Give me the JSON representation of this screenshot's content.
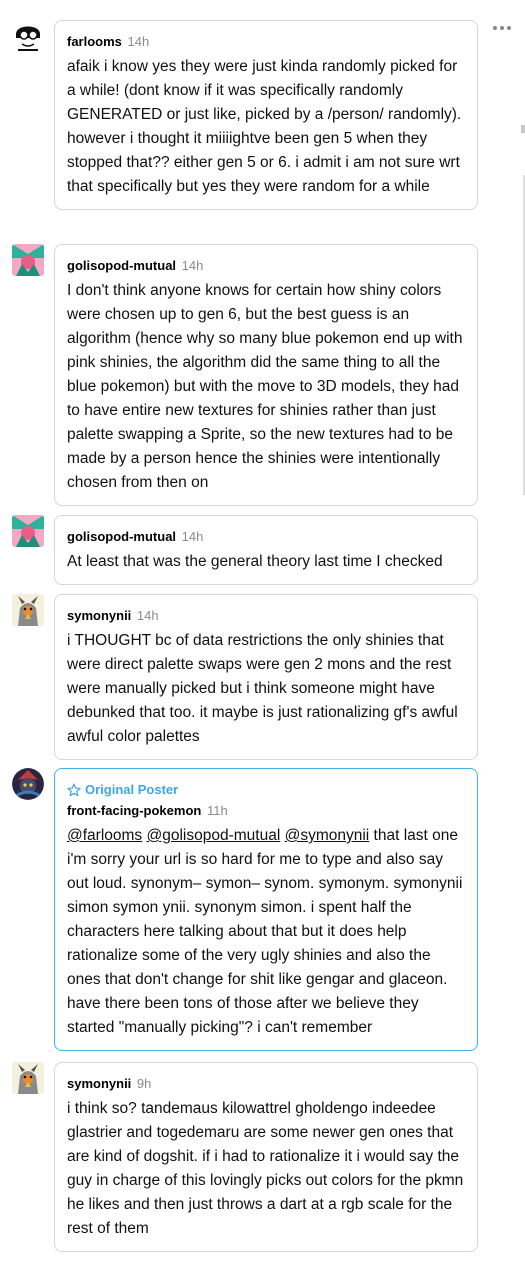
{
  "op_badge": "Original Poster",
  "replies": [
    {
      "username": "farlooms",
      "time": "14h",
      "text": "afaik i know yes they were just kinda randomly picked for a while! (dont know if it was specifically randomly GENERATED or just like, picked by a /person/ randomly). however i thought it miiiightve been gen 5 when they stopped that?? either gen 5 or 6. i admit i am not sure wrt that specifically but yes they were random for a while",
      "avatar_icon": "bw-drawing-avatar-icon"
    },
    {
      "username": "golisopod-mutual",
      "time": "14h",
      "text": "I don't think anyone knows for certain how shiny colors were chosen up to gen 6, but the best guess is an algorithm (hence why so many blue pokemon end up with pink shinies, the algorithm did the same thing to all the blue pokemon) but with the move to 3D models, they had to have entire new textures for shinies rather than just palette swapping a Sprite, so the new textures had to be made by a person hence the shinies were intentionally chosen from then on",
      "avatar_icon": "pink-teal-avatar-icon"
    },
    {
      "username": "golisopod-mutual",
      "time": "14h",
      "text": "At least that was the general theory last time I checked",
      "avatar_icon": "pink-teal-avatar-icon"
    },
    {
      "username": "symonynii",
      "time": "14h",
      "text": "i THOUGHT bc of data restrictions the only shinies that were direct palette swaps were gen 2 mons and the rest were manually picked but i think someone might have debunked that too. it maybe is just rationalizing gf's awful awful color palettes",
      "avatar_icon": "bird-avatar-icon"
    },
    {
      "username": "front-facing-pokemon",
      "time": "11h",
      "mentions": [
        "@farlooms",
        "@golisopod-mutual",
        "@symonynii"
      ],
      "text": " that last one i'm sorry your url is so hard for me to type and also say out loud. synonym– symon– synom. symonym. symonynii simon symon ynii. synonym simon. i spent half the characters here talking about that but it does help rationalize some of the very ugly shinies and also the ones that don't change for shit like gengar and glaceon. have there been tons of those after we believe they started \"manually picking\"? i can't remember",
      "avatar_icon": "dark-pokemon-avatar-icon"
    },
    {
      "username": "symonynii",
      "time": "9h",
      "text": "i think so? tandemaus kilowattrel gholdengo indeedee glastrier and togedemaru are some newer gen ones that are kind of dogshit. if i had to rationalize it i would say the guy in charge of this lovingly picks out colors for the pkmn he likes and then just throws a dart at a rgb scale for the rest of them",
      "avatar_icon": "bird-avatar-icon"
    }
  ],
  "colors": {
    "border": "#d6d6d6",
    "op_border": "#3fb3ea",
    "op_accent": "#3fa7e0",
    "time": "#8a8a8a"
  }
}
